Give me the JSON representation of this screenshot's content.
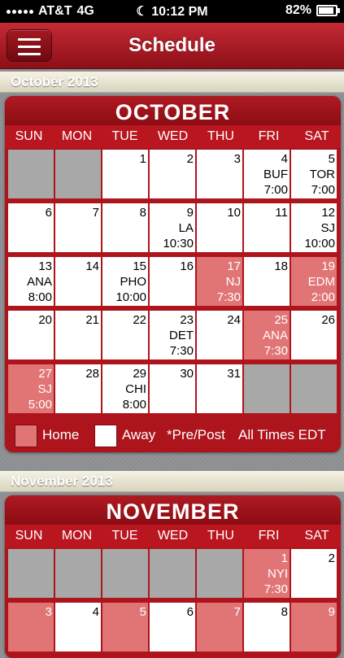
{
  "status": {
    "carrier": "AT&T",
    "network": "4G",
    "time": "10:12 PM",
    "battery": "82%",
    "battery_level": 0.82,
    "moon_icon": "moon-icon"
  },
  "nav": {
    "title": "Schedule"
  },
  "colors": {
    "accent": "#ad141c",
    "home": "#e17575",
    "away": "#ffffff",
    "empty": "#a8a8a8"
  },
  "days": [
    "SUN",
    "MON",
    "TUE",
    "WED",
    "THU",
    "FRI",
    "SAT"
  ],
  "legend": {
    "home": "Home",
    "away": "Away",
    "prepost": "*Pre/Post",
    "times": "All Times EDT"
  },
  "october": {
    "header": "October 2013",
    "title": "OCTOBER",
    "rows": [
      [
        {
          "empty": true
        },
        {
          "empty": true
        },
        {
          "num": "1"
        },
        {
          "num": "2"
        },
        {
          "num": "3"
        },
        {
          "num": "4",
          "opp": "BUF",
          "time": "7:00"
        },
        {
          "num": "5",
          "opp": "TOR",
          "time": "7:00"
        }
      ],
      [
        {
          "num": "6"
        },
        {
          "num": "7"
        },
        {
          "num": "8"
        },
        {
          "num": "9",
          "opp": "LA",
          "time": "10:30"
        },
        {
          "num": "10"
        },
        {
          "num": "11"
        },
        {
          "num": "12",
          "opp": "SJ",
          "time": "10:00"
        }
      ],
      [
        {
          "num": "13",
          "opp": "ANA",
          "time": "8:00"
        },
        {
          "num": "14"
        },
        {
          "num": "15",
          "opp": "PHO",
          "time": "10:00"
        },
        {
          "num": "16"
        },
        {
          "num": "17",
          "opp": "NJ",
          "time": "7:30",
          "home": true
        },
        {
          "num": "18"
        },
        {
          "num": "19",
          "opp": "EDM",
          "time": "2:00",
          "home": true
        }
      ],
      [
        {
          "num": "20"
        },
        {
          "num": "21"
        },
        {
          "num": "22"
        },
        {
          "num": "23",
          "opp": "DET",
          "time": "7:30"
        },
        {
          "num": "24"
        },
        {
          "num": "25",
          "opp": "ANA",
          "time": "7:30",
          "home": true
        },
        {
          "num": "26"
        }
      ],
      [
        {
          "num": "27",
          "opp": "SJ",
          "time": "5:00",
          "home": true
        },
        {
          "num": "28"
        },
        {
          "num": "29",
          "opp": "CHI",
          "time": "8:00"
        },
        {
          "num": "30"
        },
        {
          "num": "31"
        },
        {
          "empty": true
        },
        {
          "empty": true
        }
      ]
    ]
  },
  "november": {
    "header": "November 2013",
    "title": "NOVEMBER",
    "rows": [
      [
        {
          "empty": true
        },
        {
          "empty": true
        },
        {
          "empty": true
        },
        {
          "empty": true
        },
        {
          "empty": true
        },
        {
          "num": "1",
          "opp": "NYI",
          "time": "7:30",
          "home": true
        },
        {
          "num": "2"
        }
      ],
      [
        {
          "num": "3",
          "home": true
        },
        {
          "num": "4"
        },
        {
          "num": "5",
          "home": true
        },
        {
          "num": "6"
        },
        {
          "num": "7",
          "home": true
        },
        {
          "num": "8"
        },
        {
          "num": "9",
          "home": true
        }
      ]
    ]
  }
}
